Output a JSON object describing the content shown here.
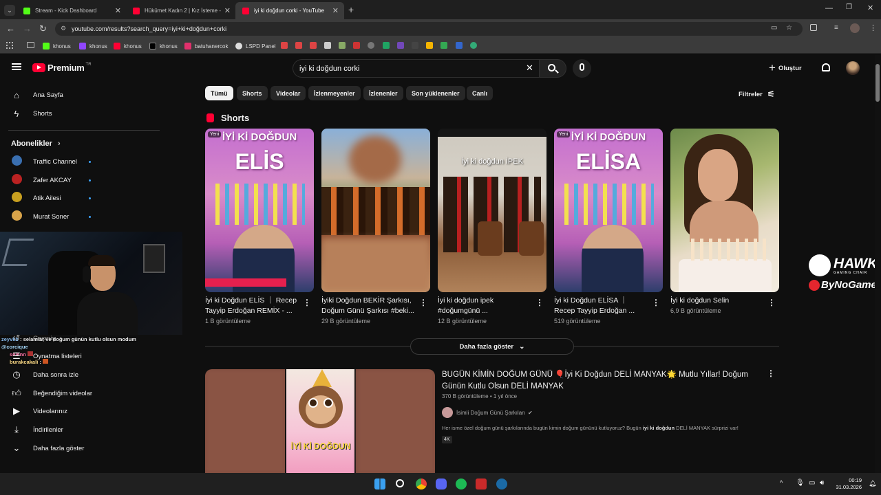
{
  "browser": {
    "tabs": [
      {
        "title": "Stream - Kick Dashboard",
        "color": "#53fc18"
      },
      {
        "title": "Hükümet Kadın 2 | Kız İsteme -",
        "color": "#ff0033"
      },
      {
        "title": "iyi ki doğdun corki - YouTube",
        "color": "#ff0033"
      }
    ],
    "url": "youtube.com/results?search_query=iyi+ki+doğdun+corki",
    "bookmarks": [
      "khonus",
      "khonus",
      "khonus",
      "khonus",
      "batuhanercok",
      "LSPD Panel"
    ]
  },
  "header": {
    "logo": "Premium",
    "logo_sup": "TR",
    "search_value": "iyi ki doğdun corki",
    "create_label": "Oluştur"
  },
  "sidebar": {
    "home": "Ana Sayfa",
    "shorts": "Shorts",
    "subs_title": "Abonelikler",
    "subs": [
      "Traffic Channel",
      "Zafer AKCAY",
      "Atik Ailesi",
      "Murat Soner"
    ],
    "you_items": [
      "Geçmiş",
      "Oynatma listeleri",
      "Daha sonra izle",
      "Beğendiğim videolar",
      "Videolarınız",
      "İndirilenler",
      "Daha fazla göster"
    ]
  },
  "chips": [
    "Tümü",
    "Shorts",
    "Videolar",
    "İzlenmeyenler",
    "İzlenenler",
    "Son yüklenenler",
    "Canlı"
  ],
  "filters_label": "Filtreler",
  "shorts_section": {
    "title": "Shorts",
    "items": [
      {
        "badge": "Yeni",
        "overlay": "İYİ Kİ DOĞDUN",
        "overlay2": "ELİS",
        "title": "İyi ki Doğdun ELİS ｜ Recep Tayyip Erdoğan REMİX - ...",
        "views": "1 B görüntüleme"
      },
      {
        "badge": "",
        "overlay": "",
        "overlay2": "",
        "title": "İyiki Doğdun BEKİR Şarkısı, Doğum Günü Şarkısı #beki...",
        "views": "29 B görüntüleme"
      },
      {
        "badge": "",
        "overlay": "İyi ki doğdun İPEK",
        "overlay2": "",
        "title": "İyi ki doğdun ipek #doğumgünü ...",
        "views": "12 B görüntüleme"
      },
      {
        "badge": "Yeni",
        "overlay": "İYİ Kİ DOĞDUN",
        "overlay2": "ELİSA",
        "title": "İyi ki Doğdun ELİSA ｜ Recep Tayyip Erdoğan ...",
        "views": "519 görüntüleme"
      },
      {
        "badge": "",
        "overlay": "",
        "overlay2": "",
        "title": "İyi ki doğdun Selin",
        "views": "6,9 B görüntüleme"
      }
    ],
    "show_more": "Daha fazla göster"
  },
  "video": {
    "title": "BUGÜN KİMİN DOĞUM GÜNÜ 🎈İyi Ki Doğdun DELİ MANYAK🌟 Mutlu Yıllar! Doğum Günün Kutlu Olsun DELİ MANYAK",
    "views": "370 B görüntüleme",
    "age": "1 yıl önce",
    "channel": "İsimli Doğum Günü Şarkıları",
    "desc_pre": "Her isme özel doğum günü şarkılarında bugün kimin doğum gününü kutluyoruz? Bugün ",
    "desc_bold": "iyi ki doğdun",
    "desc_post": " DELİ MANYAK sürprizi var!",
    "quality": "4K",
    "thumb_text": "İYİ Kİ DOĞDUN"
  },
  "chat": {
    "lines": [
      {
        "user": "zeyvkb",
        "msg": "selamlar ve doğum günün kutlu olsun modum"
      },
      {
        "user": "@corcique",
        "msg": ""
      },
      {
        "user": "selenn",
        "msg": ""
      },
      {
        "user": "burakcakali",
        "msg": ""
      }
    ]
  },
  "overlay_brand": {
    "line1": "HAWK",
    "line1_sub": "GAMING CHAIR",
    "line2": "ByNoGame"
  },
  "taskbar": {
    "time": "00:19",
    "date": "31.03.2026"
  }
}
